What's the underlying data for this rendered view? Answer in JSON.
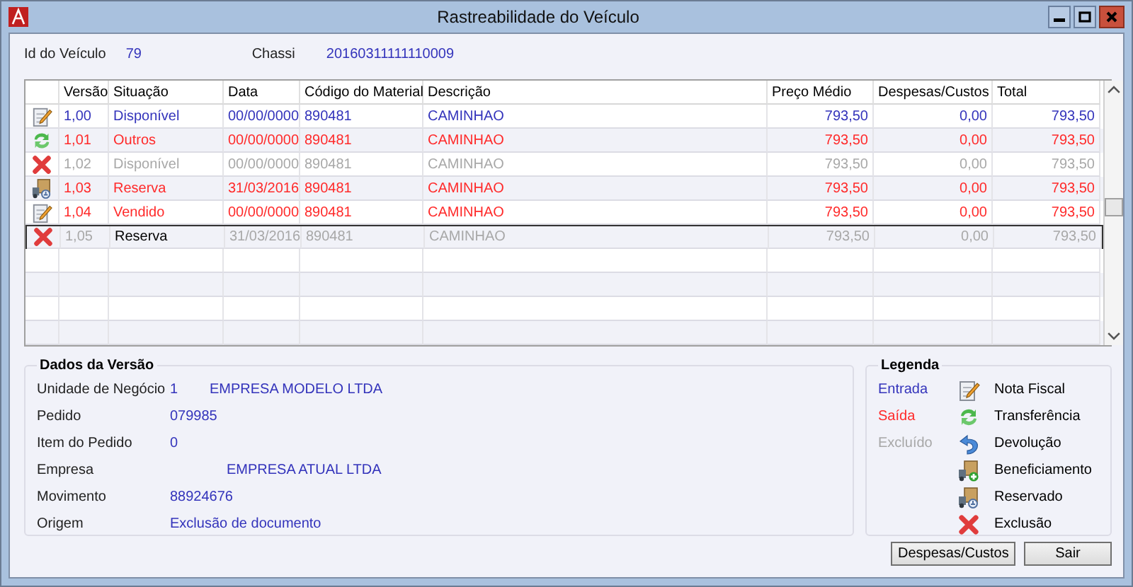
{
  "window": {
    "title": "Rastreabilidade do Veículo"
  },
  "vehicle": {
    "id_label": "Id do Veículo",
    "id": "79",
    "chassis_label": "Chassi",
    "chassis": "20160311111110009"
  },
  "table": {
    "columns": [
      "Versão",
      "Situação",
      "Data",
      "Código do Material",
      "Descrição",
      "Preço Médio",
      "Despesas/Custos",
      "Total"
    ],
    "rows": [
      {
        "kind": "note",
        "color": "#3333bb",
        "version": "1,00",
        "situation": "Disponível",
        "date": "00/00/0000",
        "material_code": "890481",
        "description": "CAMINHAO",
        "average_price": "793,50",
        "expenses": "0,00",
        "total": "793,50",
        "selected": false
      },
      {
        "kind": "transfer",
        "color": "#ff2a2a",
        "version": "1,01",
        "situation": "Outros",
        "date": "00/00/0000",
        "material_code": "890481",
        "description": "CAMINHAO",
        "average_price": "793,50",
        "expenses": "0,00",
        "total": "793,50",
        "selected": false
      },
      {
        "kind": "delete",
        "color": "#a8a8a8",
        "version": "1,02",
        "situation": "Disponível",
        "date": "00/00/0000",
        "material_code": "890481",
        "description": "CAMINHAO",
        "average_price": "793,50",
        "expenses": "0,00",
        "total": "793,50",
        "selected": false
      },
      {
        "kind": "reserve",
        "color": "#ff2a2a",
        "version": "1,03",
        "situation": "Reserva",
        "date": "31/03/2016",
        "material_code": "890481",
        "description": "CAMINHAO",
        "average_price": "793,50",
        "expenses": "0,00",
        "total": "793,50",
        "selected": false
      },
      {
        "kind": "note",
        "color": "#ff2a2a",
        "version": "1,04",
        "situation": "Vendido",
        "date": "00/00/0000",
        "material_code": "890481",
        "description": "CAMINHAO",
        "average_price": "793,50",
        "expenses": "0,00",
        "total": "793,50",
        "selected": false
      },
      {
        "kind": "delete",
        "color": "#a8a8a8",
        "version": "1,05",
        "situation": "Reserva",
        "date": "31/03/2016",
        "material_code": "890481",
        "description": "CAMINHAO",
        "average_price": "793,50",
        "expenses": "0,00",
        "total": "793,50",
        "selected": true
      }
    ]
  },
  "details": {
    "title": "Dados da Versão",
    "fields": [
      {
        "kind": "coded",
        "label": "Unidade de Negócio",
        "code": "1",
        "value": "EMPRESA MODELO LTDA"
      },
      {
        "kind": "plain",
        "label": "Pedido",
        "value": "079985"
      },
      {
        "kind": "plain",
        "label": "Item do Pedido",
        "value": "0"
      },
      {
        "kind": "offset",
        "label": "Empresa",
        "value": "EMPRESA ATUAL LTDA"
      },
      {
        "kind": "plain",
        "label": "Movimento",
        "value": "88924676"
      },
      {
        "kind": "plain",
        "label": "Origem",
        "value": "Exclusão de documento"
      }
    ]
  },
  "legend": {
    "title": "Legenda",
    "statuses": [
      {
        "label": "Entrada",
        "color": "#3333bb"
      },
      {
        "label": "Saída",
        "color": "#ff2a2a"
      },
      {
        "label": "Excluído",
        "color": "#a8a8a8"
      }
    ],
    "types": [
      {
        "kind": "note",
        "label": "Nota Fiscal"
      },
      {
        "kind": "transfer",
        "label": "Transferência"
      },
      {
        "kind": "return",
        "label": "Devolução"
      },
      {
        "kind": "process",
        "label": "Beneficiamento"
      },
      {
        "kind": "reserve",
        "label": "Reservado"
      },
      {
        "kind": "delete",
        "label": "Exclusão"
      }
    ]
  },
  "buttons": [
    "Despesas/Custos",
    "Sair"
  ]
}
